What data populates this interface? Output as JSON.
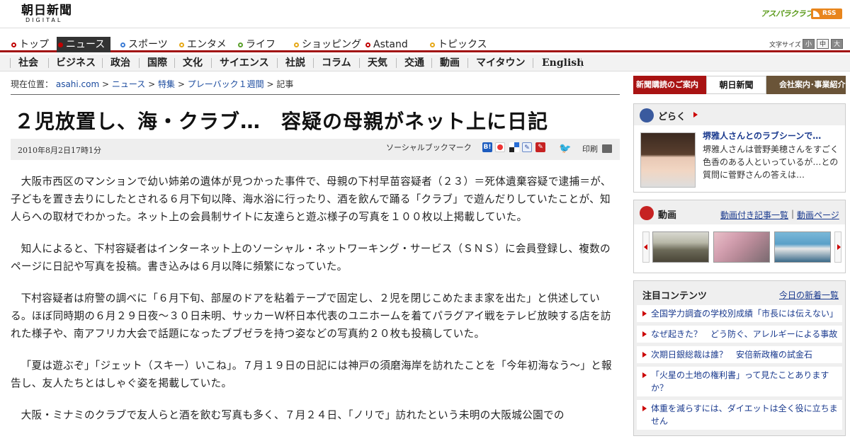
{
  "header": {
    "logo_main": "朝日新聞",
    "logo_sub": "DIGITAL",
    "asparaclub": "アスパラクラブ",
    "rss": "RSS"
  },
  "main_nav": {
    "items": [
      {
        "label": "トップ",
        "dot_color": "#c00000"
      },
      {
        "label": "ニュース",
        "dot_color": "#c00000",
        "active": true
      },
      {
        "label": "スポーツ",
        "dot_color": "#3a7bd5"
      },
      {
        "label": "エンタメ",
        "dot_color": "#e6a817"
      },
      {
        "label": "ライフ",
        "dot_color": "#5aa02c"
      },
      {
        "label": "ショッピング",
        "dot_color": "#e6a817"
      },
      {
        "label": "Astand",
        "dot_color": "#c00000"
      },
      {
        "label": "トピックス",
        "dot_color": "#e6a817"
      }
    ],
    "font_size_label": "文字サイズ",
    "font_sizes": [
      "小",
      "中",
      "大"
    ]
  },
  "sub_nav": {
    "items": [
      "社会",
      "ビジネス",
      "政治",
      "国際",
      "文化",
      "サイエンス",
      "社説",
      "コラム",
      "天気",
      "交通",
      "動画",
      "マイタウン",
      "English"
    ]
  },
  "breadcrumb": {
    "prefix": "現在位置：",
    "items": [
      "asahi.com",
      "ニュース",
      "特集",
      "プレーバック１週間",
      "記事"
    ]
  },
  "article": {
    "title": "２児放置し、海・クラブ…　容疑の母親がネット上に日記",
    "date": "2010年8月2日17時1分",
    "social_label": "ソーシャルブックマーク",
    "print_label": "印刷",
    "paragraphs": [
      "大阪市西区のマンションで幼い姉弟の遺体が見つかった事件で、母親の下村早苗容疑者（２３）＝死体遺棄容疑で逮捕＝が、子どもを置き去りにしたとされる６月下旬以降、海水浴に行ったり、酒を飲んで踊る「クラブ」で遊んだりしていたことが、知人らへの取材でわかった。ネット上の会員制サイトに友達らと遊ぶ様子の写真を１００枚以上掲載していた。",
      "知人によると、下村容疑者はインターネット上のソーシャル・ネットワーキング・サービス（ＳＮＳ）に会員登録し、複数のページに日記や写真を投稿。書き込みは６月以降に頻繁になっていた。",
      "下村容疑者は府警の調べに「６月下旬、部屋のドアを粘着テープで固定し、２児を閉じこめたまま家を出た」と供述している。ほぼ同時期の６月２９日夜～３０日未明、サッカーＷ杯日本代表のユニホームを着てパラグアイ戦をテレビ放映する店を訪れた様子や、南アフリカ大会で話題になったブブゼラを持つ姿などの写真約２０枚も投稿していた。",
      "「夏は遊ぶぞ」「ジェット（スキー）いこね」。７月１９日の日記には神戸の須磨海岸を訪れたことを「今年初海なう～」と報告し、友人たちとはしゃぐ姿を掲載していた。",
      "大阪・ミナミのクラブで友人らと酒を飲む写真も多く、７月２４日、「ノリで」訪れたという未明の大阪城公園での"
    ]
  },
  "sidebar": {
    "promo": {
      "left": "新聞購読のご案内",
      "mid": "朝日新聞",
      "right": "会社案内･事業紹介"
    },
    "doraku": {
      "title": "どらく",
      "headline": "堺雅人さんとのラブシーンで…",
      "text": "堺雅人さんは菅野美穂さんをすごく色香のある人といっているが…との質問に菅野さんの答えは…"
    },
    "video": {
      "title": "動画",
      "link1": "動画付き記事一覧",
      "separator": "|",
      "link2": "動画ページ"
    },
    "featured": {
      "title": "注目コンテンツ",
      "link": "今日の新着一覧",
      "items": [
        "全国学力調査の学校別成績「市長には伝えない」",
        "なぜ起きた？　どう防ぐ、アレルギーによる事故",
        "次期日銀総裁は誰？　安倍新政権の試金石",
        "「火星の土地の権利書」って見たことありますか？",
        "体重を減らすには、ダイエットは全く役に立ちません"
      ]
    }
  }
}
